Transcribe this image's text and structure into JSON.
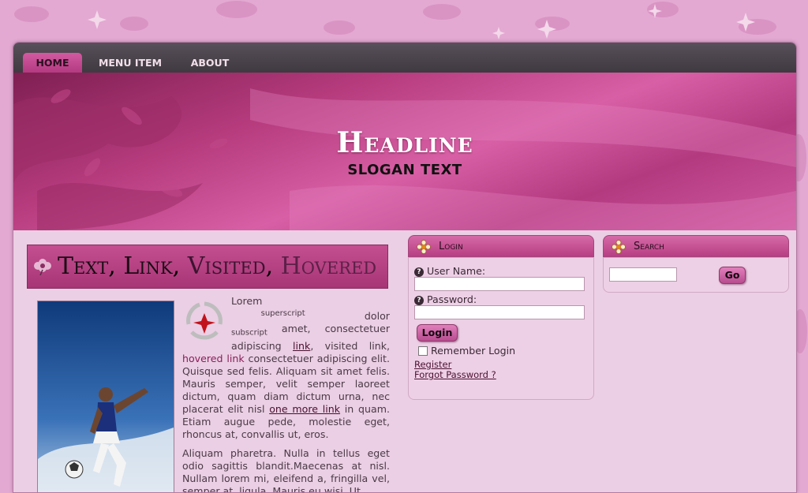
{
  "nav": {
    "items": [
      {
        "label": "HOME",
        "active": true
      },
      {
        "label": "MENU ITEM",
        "active": false
      },
      {
        "label": "ABOUT",
        "active": false
      }
    ]
  },
  "banner": {
    "headline": "Headline",
    "slogan": "SLOGAN TEXT"
  },
  "content": {
    "heading": {
      "text": "Text",
      "link": "Link",
      "visited": "Visited",
      "hovered": "Hovered",
      "sep": ", "
    },
    "article": {
      "lorem": "Lorem",
      "superscript": "superscript",
      "dolor": "dolor",
      "subscript": "subscript",
      "amet": " amet, consectetuer adipiscing ",
      "link": "link",
      "visited": ", visited link, ",
      "hovered": "hovered link",
      "rest1": " consectetuer adipiscing elit. Quisque sed felis. Aliquam sit amet felis. Mauris semper, velit semper laoreet dictum, quam diam dictum urna, nec placerat elit nisl ",
      "one_more_link": "one more link",
      "rest2": " in quam. Etiam augue pede, molestie eget, rhoncus at, convallis ut, eros.",
      "para2": "Aliquam pharetra. Nulla in tellus eget odio sagittis blandit.Maecenas at nisl. Nullam lorem mi, eleifend a, fringilla vel, semper at, ligula. Mauris eu wisi. Ut"
    }
  },
  "login": {
    "title": "Login",
    "username_label": "User Name:",
    "password_label": "Password:",
    "username_value": "",
    "password_value": "",
    "button_label": "Login",
    "remember_label": "Remember Login",
    "remember_checked": false,
    "register_link": "Register",
    "forgot_link": "Forgot Password ?"
  },
  "search": {
    "title": "Search",
    "input_value": "",
    "button_label": "Go"
  }
}
